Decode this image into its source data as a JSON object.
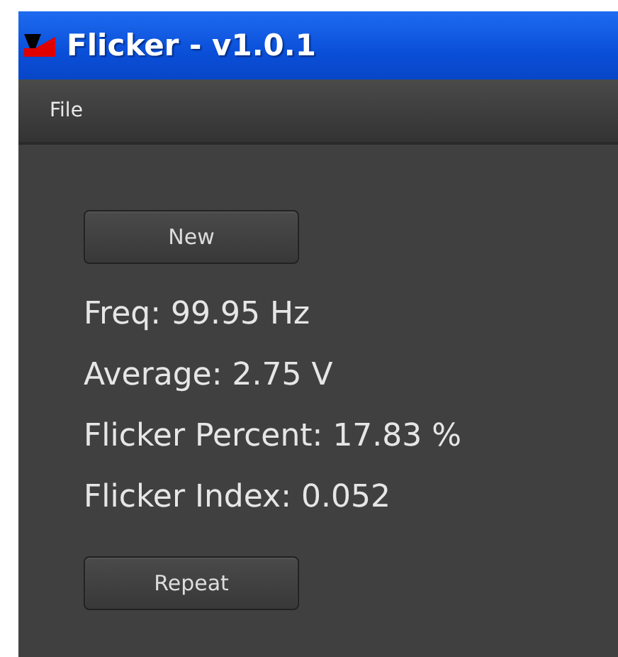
{
  "window": {
    "title": "Flicker - v1.0.1"
  },
  "menu": [
    "File"
  ],
  "buttons_top": [
    "New"
  ],
  "readings": [
    "Freq: 99.95 Hz",
    "Average: 2.75 V",
    "Flicker Percent: 17.83 %",
    "Flicker Index: 0.052"
  ],
  "buttons_bottom": [
    "Repeat"
  ]
}
